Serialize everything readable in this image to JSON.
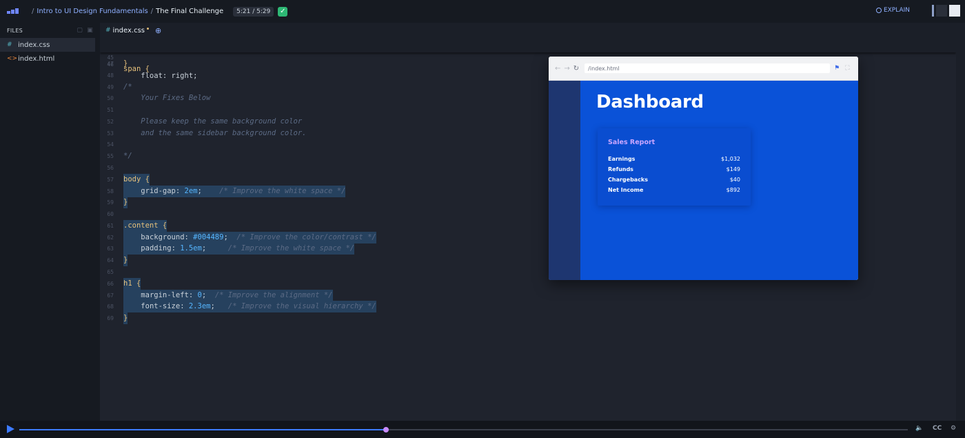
{
  "header": {
    "breadcrumb_course": "Intro to UI Design Fundamentals",
    "breadcrumb_sep": "/",
    "lesson_title": "The Final Challenge",
    "time": "5:21 / 5:29",
    "check": "✓",
    "explain_label": "EXPLAIN"
  },
  "sidebar": {
    "title": "FILES",
    "files": [
      {
        "icon": "#",
        "name": "index.css"
      },
      {
        "icon": "<>",
        "name": "index.html"
      }
    ]
  },
  "editor": {
    "tab_icon": "#",
    "tab_name": "index.css",
    "sticky": {
      "ln": "45",
      "text": "span {"
    },
    "lines": [
      {
        "ln": "47",
        "code": "}"
      },
      {
        "ln": "48",
        "code": ""
      },
      {
        "ln": "49",
        "code": "/*"
      },
      {
        "ln": "50",
        "code": "    Your Fixes Below"
      },
      {
        "ln": "51",
        "code": ""
      },
      {
        "ln": "52",
        "code": "    Please keep the same background color"
      },
      {
        "ln": "53",
        "code": "    and the same sidebar background color."
      },
      {
        "ln": "54",
        "code": ""
      },
      {
        "ln": "55",
        "code": "*/"
      },
      {
        "ln": "56",
        "code": ""
      },
      {
        "ln": "57",
        "code": "body {"
      },
      {
        "ln": "58",
        "code": "    grid-gap: 2em;    /* Improve the white space */"
      },
      {
        "ln": "59",
        "code": "}"
      },
      {
        "ln": "60",
        "code": ""
      },
      {
        "ln": "61",
        "code": ".content {"
      },
      {
        "ln": "62",
        "code": "    background: #004489;  /* Improve the color/contrast */"
      },
      {
        "ln": "63",
        "code": "    padding: 1.5em;     /* Improve the white space */"
      },
      {
        "ln": "64",
        "code": "}"
      },
      {
        "ln": "65",
        "code": ""
      },
      {
        "ln": "66",
        "code": "h1 {"
      },
      {
        "ln": "67",
        "code": "    margin-left: 0;  /* Improve the alignment */"
      },
      {
        "ln": "68",
        "code": "    font-size: 2.3em;   /* Improve the visual hierarchy */"
      },
      {
        "ln": "69",
        "code": "}"
      }
    ],
    "partial_line": "    float: right;"
  },
  "preview": {
    "url": "/index.html",
    "heading": "Dashboard",
    "card_title": "Sales Report",
    "rows": [
      {
        "label": "Earnings",
        "value": "$1,032"
      },
      {
        "label": "Refunds",
        "value": "$149"
      },
      {
        "label": "Chargebacks",
        "value": "$40"
      },
      {
        "label": "Net Income",
        "value": "$892"
      }
    ]
  },
  "player": {
    "progress": 0.413,
    "cc_label": "CC"
  }
}
